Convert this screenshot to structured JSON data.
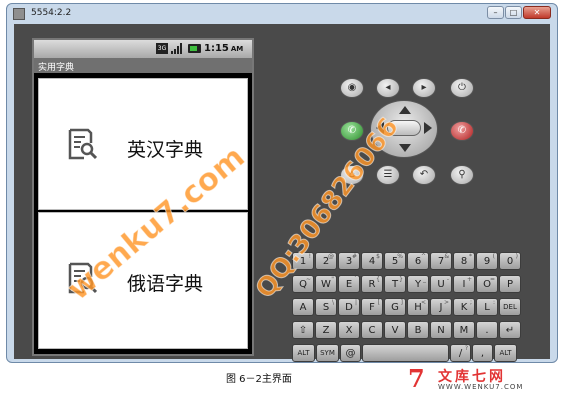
{
  "window": {
    "title": "5554:2.2",
    "buttons": {
      "minimize": "–",
      "maximize": "□",
      "close": "✕"
    }
  },
  "phone": {
    "status_bar": {
      "network": "3G",
      "time": "1:15",
      "time_suffix": "AM"
    },
    "app_title": "实用字典",
    "tiles": [
      {
        "label": "英汉字典",
        "icon": "dictionary-search-icon"
      },
      {
        "label": "俄语字典",
        "icon": "dictionary-search-icon"
      }
    ]
  },
  "controls": {
    "icons": [
      "camera-icon",
      "volume-down-icon",
      "volume-up-icon",
      "power-icon",
      "call-icon",
      "end-call-icon",
      "home-icon",
      "menu-icon",
      "back-icon",
      "search-icon"
    ],
    "glyphs": {
      "camera": "◉",
      "vol_down": "◂",
      "vol_up": "▸",
      "power": "⏻",
      "call": "✆",
      "end_call": "✆",
      "home": "⌂",
      "menu": "☰",
      "back": "↶",
      "search": "⚲"
    }
  },
  "keyboard": {
    "row1": [
      {
        "k": "1",
        "a": "!"
      },
      {
        "k": "2",
        "a": "@"
      },
      {
        "k": "3",
        "a": "#"
      },
      {
        "k": "4",
        "a": "$"
      },
      {
        "k": "5",
        "a": "%"
      },
      {
        "k": "6",
        "a": "^"
      },
      {
        "k": "7",
        "a": "&"
      },
      {
        "k": "8",
        "a": "*"
      },
      {
        "k": "9",
        "a": "("
      },
      {
        "k": "0",
        "a": ")"
      }
    ],
    "row2": [
      {
        "k": "Q",
        "a": "~"
      },
      {
        "k": "W",
        "a": "\""
      },
      {
        "k": "E",
        "a": "`"
      },
      {
        "k": "R",
        "a": "{"
      },
      {
        "k": "T",
        "a": "}"
      },
      {
        "k": "Y",
        "a": "_"
      },
      {
        "k": "U",
        "a": "-"
      },
      {
        "k": "I",
        "a": "+"
      },
      {
        "k": "O",
        "a": "="
      },
      {
        "k": "P",
        "a": ""
      }
    ],
    "row3": [
      {
        "k": "A",
        "a": ""
      },
      {
        "k": "S",
        "a": "\\"
      },
      {
        "k": "D",
        "a": "|"
      },
      {
        "k": "F",
        "a": "["
      },
      {
        "k": "G",
        "a": "]"
      },
      {
        "k": "H",
        "a": "<"
      },
      {
        "k": "J",
        "a": ">"
      },
      {
        "k": "K",
        "a": ";"
      },
      {
        "k": "L",
        "a": ":"
      },
      {
        "k": "DEL",
        "a": ""
      }
    ],
    "row4": [
      {
        "k": "⇧",
        "a": ""
      },
      {
        "k": "Z",
        "a": ""
      },
      {
        "k": "X",
        "a": ""
      },
      {
        "k": "C",
        "a": ""
      },
      {
        "k": "V",
        "a": ""
      },
      {
        "k": "B",
        "a": ""
      },
      {
        "k": "N",
        "a": ""
      },
      {
        "k": "M",
        "a": ""
      },
      {
        "k": ".",
        "a": ""
      },
      {
        "k": "↵",
        "a": ""
      }
    ],
    "row5": [
      {
        "k": "ALT",
        "a": ""
      },
      {
        "k": "SYM",
        "a": ""
      },
      {
        "k": "@",
        "a": ""
      },
      {
        "k": "",
        "a": ""
      },
      {
        "k": "/",
        "a": "?"
      },
      {
        "k": ",",
        "a": ""
      },
      {
        "k": "ALT",
        "a": ""
      }
    ]
  },
  "caption": "图 6－2主界面",
  "watermarks": [
    "wenku7.com",
    "QQ:306826066"
  ],
  "logo": {
    "mark": "7",
    "text": "文库七网",
    "url": "WWW.WENKU7.COM"
  }
}
